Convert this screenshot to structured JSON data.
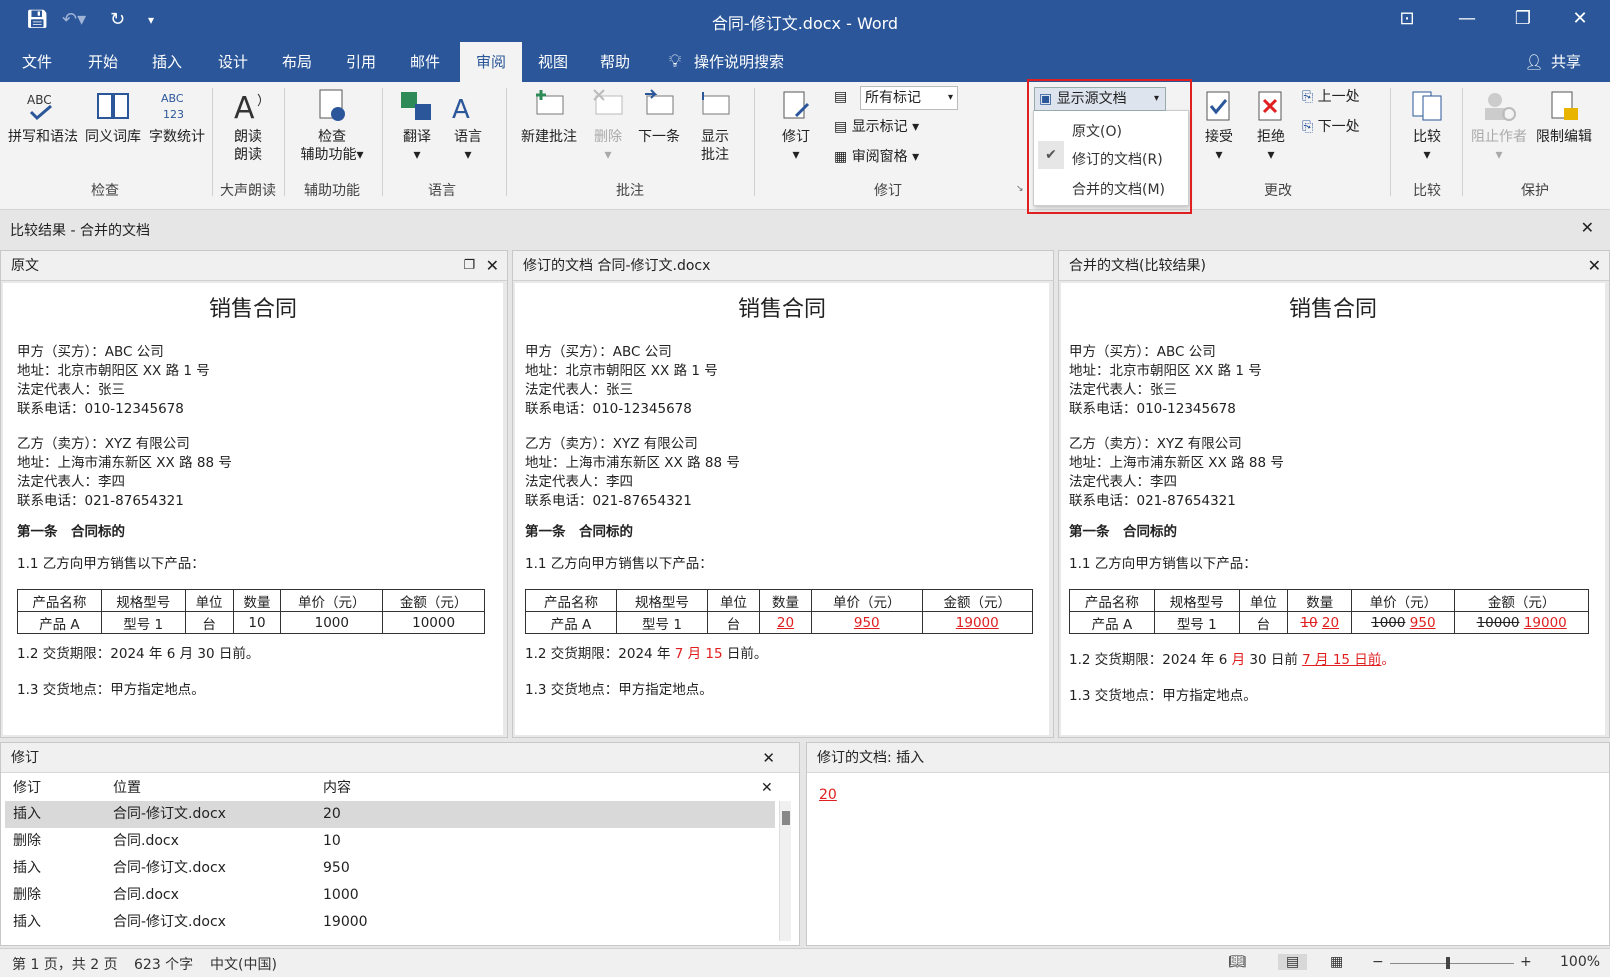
{
  "window": {
    "title": "合同-修订文.docx  -  Word"
  },
  "tabs": [
    "文件",
    "开始",
    "插入",
    "设计",
    "布局",
    "引用",
    "邮件",
    "审阅",
    "视图",
    "帮助",
    "操作说明搜索"
  ],
  "share": "共享",
  "ribbon": {
    "proofing": {
      "spell": "拼写和语法",
      "thesaurus": "同义词库",
      "wordcount": "字数统计",
      "group": "检查"
    },
    "speech": {
      "read1": "朗读",
      "read2": "朗读",
      "group": "大声朗读"
    },
    "access": {
      "check1": "检查",
      "check2": "辅助功能",
      "group": "辅助功能"
    },
    "language": {
      "translate": "翻译",
      "lang": "语言",
      "group": "语言"
    },
    "comments": {
      "new": "新建批注",
      "delete": "删除",
      "next": "下一条",
      "show1": "显示",
      "show2": "批注",
      "group": "批注"
    },
    "tracking": {
      "track": "修订",
      "markup": "所有标记",
      "showmarkup": "显示标记",
      "pane": "审阅窗格",
      "group": "修订"
    },
    "sourcedoc": {
      "label": "显示源文档",
      "items": [
        "原文(O)",
        "修订的文档(R)",
        "合并的文档(M)"
      ]
    },
    "changes": {
      "accept": "接受",
      "reject": "拒绝",
      "prev": "上一处",
      "next": "下一处",
      "group": "更改"
    },
    "compare": {
      "label": "比较",
      "group": "比较"
    },
    "protect": {
      "block": "阻止作者",
      "restrict": "限制编辑",
      "group": "保护"
    }
  },
  "compare_bar": {
    "title": "比较结果 - 合并的文档"
  },
  "panes": {
    "original": {
      "title": "原文"
    },
    "revised": {
      "title": "修订的文档   合同-修订文.docx"
    },
    "merged": {
      "title": "合并的文档(比较结果)"
    }
  },
  "doc": {
    "title": "销售合同",
    "partyA": [
      "甲方（买方）：ABC 公司",
      "地址：北京市朝阳区 XX 路 1 号",
      "法定代表人：张三",
      "联系电话：010-12345678"
    ],
    "partyB": [
      "乙方（卖方）：XYZ 有限公司",
      "地址：上海市浦东新区 XX 路 88 号",
      "法定代表人：李四",
      "联系电话：021-87654321"
    ],
    "article1": "第一条　合同标的",
    "clause11": "1.1  乙方向甲方销售以下产品：",
    "table_headers": [
      "产品名称",
      "规格型号",
      "单位",
      "数量",
      "单价（元）",
      "金额（元）"
    ],
    "table_row": [
      "产品 A",
      "型号 1",
      "台"
    ],
    "orig_values": [
      "10",
      "1000",
      "10000"
    ],
    "rev_values": [
      "20",
      "950",
      "19000"
    ],
    "clause12_prefix": "1.2  交货期限：2024 年 ",
    "clause12_orig": "1.2  交货期限：2024 年 6 月 30 日前。",
    "clause12_rev_month": "7 月 15",
    "clause12_suffix": " 日前。",
    "merged_c12_a": "1.2  交货期限：2024 年 6 ",
    "merged_c12_b": "月",
    "merged_c12_c": " 30 日前 ",
    "merged_c12_d": "7 月 15 日前",
    "merged_c12_e": "。",
    "clause13": "1.3  交货地点：甲方指定地点。"
  },
  "revisions": {
    "title": "修订",
    "headers": [
      "修订",
      "位置",
      "内容"
    ],
    "rows": [
      {
        "type": "插入",
        "loc": "合同-修订文.docx",
        "content": "20"
      },
      {
        "type": "删除",
        "loc": "合同.docx",
        "content": "10"
      },
      {
        "type": "插入",
        "loc": "合同-修订文.docx",
        "content": "950"
      },
      {
        "type": "删除",
        "loc": "合同.docx",
        "content": "1000"
      },
      {
        "type": "插入",
        "loc": "合同-修订文.docx",
        "content": "19000"
      }
    ]
  },
  "detail": {
    "title": "修订的文档: 插入",
    "value": "20"
  },
  "status": {
    "page": "第 1 页，共 2 页",
    "words": "623 个字",
    "lang": "中文(中国)",
    "zoom": "100%"
  }
}
